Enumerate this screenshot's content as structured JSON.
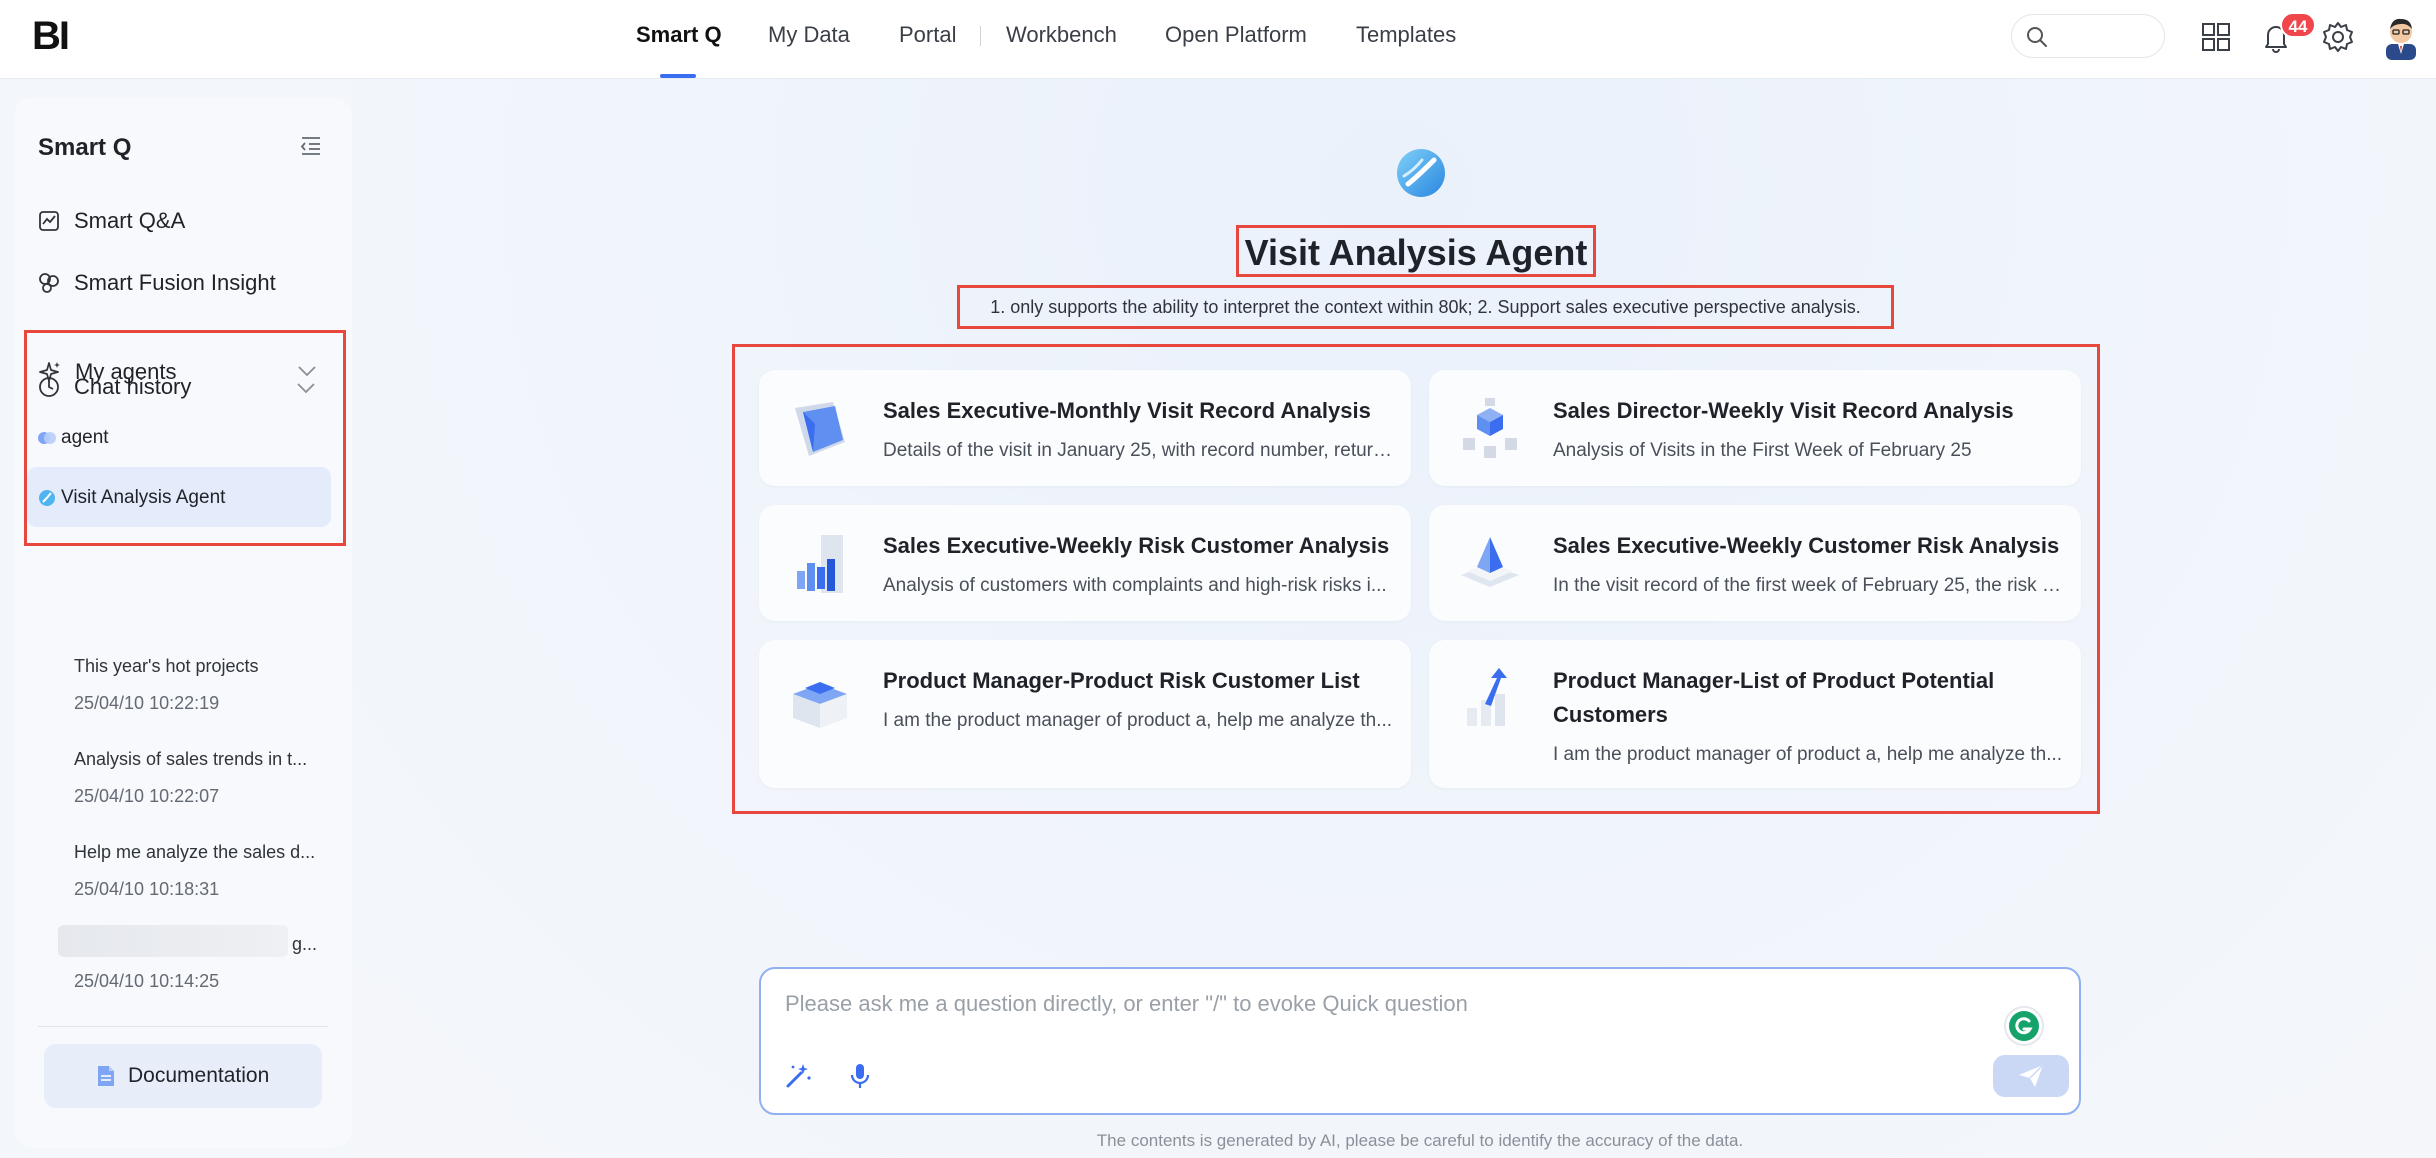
{
  "brand": {
    "logo": "BI"
  },
  "nav": {
    "items": [
      {
        "label": "Smart Q",
        "active": true
      },
      {
        "label": "My Data"
      },
      {
        "label": "Portal"
      },
      {
        "label": "Workbench"
      },
      {
        "label": "Open Platform"
      },
      {
        "label": "Templates"
      }
    ],
    "search_placeholder": "",
    "notifications_count": "44"
  },
  "sidebar": {
    "title": "Smart Q",
    "links": [
      {
        "label": "Smart Q&A",
        "icon": "chart-box-icon"
      },
      {
        "label": "Smart Fusion Insight",
        "icon": "fusion-icon"
      }
    ],
    "agents_section": {
      "label": "My agents",
      "items": [
        {
          "label": "agent",
          "active": false
        },
        {
          "label": "Visit Analysis Agent",
          "active": true
        }
      ]
    },
    "history_section": {
      "label": "Chat history",
      "items": [
        {
          "question": "This year's hot projects",
          "time": "25/04/10 10:22:19"
        },
        {
          "question": "Analysis of sales trends in t...",
          "time": "25/04/10 10:22:07"
        },
        {
          "question": "Help me analyze the sales d...",
          "time": "25/04/10 10:18:31"
        },
        {
          "question": "g...",
          "time": "25/04/10 10:14:25"
        }
      ]
    },
    "documentation_label": "Documentation"
  },
  "agent": {
    "title": "Visit Analysis Agent",
    "description": "1. only supports the ability to interpret the context within 80k; 2. Support sales executive perspective analysis.",
    "cards": [
      {
        "title": "Sales Executive-Monthly Visit Record Analysis",
        "desc": "Details of the visit in January 25, with record number, return...",
        "icon": "folder-icon"
      },
      {
        "title": "Sales Director-Weekly Visit Record Analysis",
        "desc": "Analysis of Visits in the First Week of February 25",
        "icon": "cubes-icon"
      },
      {
        "title": "Sales Executive-Weekly Risk Customer Analysis",
        "desc": "Analysis of customers with complaints and high-risk risks i...",
        "icon": "bar-chart-icon"
      },
      {
        "title": "Sales Executive-Weekly Customer Risk Analysis",
        "desc": "In the visit record of the first week of February 25, the risk p...",
        "icon": "pyramid-icon"
      },
      {
        "title": "Product Manager-Product Risk Customer List",
        "desc": "I am the product manager of product a, help me analyze th...",
        "icon": "box-icon"
      },
      {
        "title": "Product Manager-List of Product Potential Customers",
        "desc": "I am the product manager of product a, help me analyze th...",
        "icon": "growth-arrow-icon"
      }
    ]
  },
  "composer": {
    "placeholder": "Please ask me a question directly, or enter \"/\" to evoke Quick question",
    "disclaimer": "The contents is generated by AI, please be careful to identify the accuracy of the data."
  },
  "colors": {
    "accent": "#3a6df0",
    "highlight_box": "#e8473d",
    "badge": "#f0454b"
  }
}
